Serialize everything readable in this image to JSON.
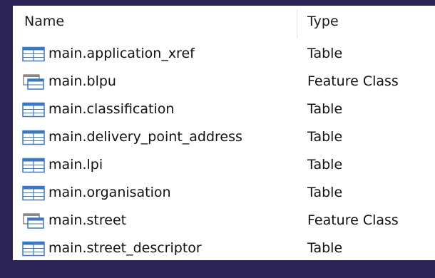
{
  "columns": {
    "name": "Name",
    "type": "Type"
  },
  "rows": [
    {
      "name": "main.application_xref",
      "type": "Table",
      "icon": "table-icon"
    },
    {
      "name": "main.blpu",
      "type": "Feature Class",
      "icon": "feature-class-icon"
    },
    {
      "name": "main.classification",
      "type": "Table",
      "icon": "table-icon"
    },
    {
      "name": "main.delivery_point_address",
      "type": "Table",
      "icon": "table-icon"
    },
    {
      "name": "main.lpi",
      "type": "Table",
      "icon": "table-icon"
    },
    {
      "name": "main.organisation",
      "type": "Table",
      "icon": "table-icon"
    },
    {
      "name": "main.street",
      "type": "Feature Class",
      "icon": "feature-class-icon"
    },
    {
      "name": "main.street_descriptor",
      "type": "Table",
      "icon": "table-icon"
    }
  ],
  "colors": {
    "frame": "#2b2256",
    "background": "#ffffff",
    "icon_blue": "#3a78c2"
  }
}
